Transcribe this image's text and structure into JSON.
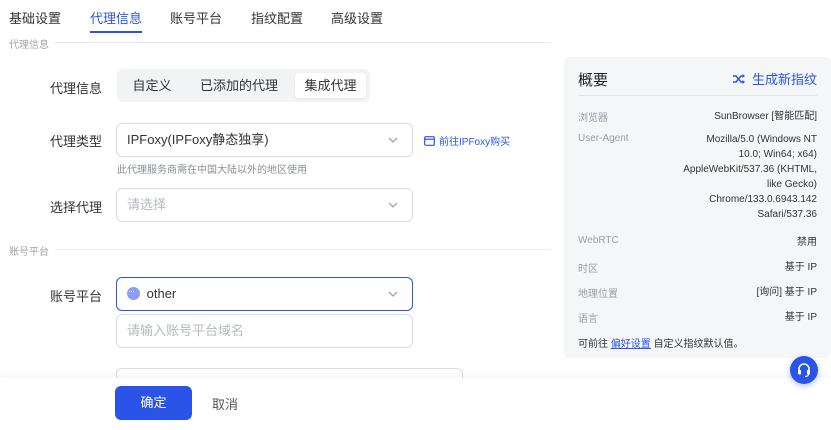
{
  "tabs": [
    {
      "label": "基础设置"
    },
    {
      "label": "代理信息"
    },
    {
      "label": "账号平台"
    },
    {
      "label": "指纹配置"
    },
    {
      "label": "高级设置"
    }
  ],
  "active_tab": "代理信息",
  "sections": {
    "proxy": "代理信息",
    "account": "账号平台"
  },
  "proxy": {
    "info_label": "代理信息",
    "modes": [
      "自定义",
      "已添加的代理",
      "集成代理"
    ],
    "active_mode": "集成代理",
    "type_label": "代理类型",
    "type_value": "IPFoxy(IPFoxy静态独享)",
    "buy_link": "前往IPFoxy购买",
    "help_text": "此代理服务商需在中国大陆以外的地区使用",
    "select_label": "选择代理",
    "select_placeholder": "请选择"
  },
  "account": {
    "platform_label": "账号平台",
    "platform_value": "other",
    "domain_placeholder": "请输入账号平台域名"
  },
  "footer": {
    "confirm": "确定",
    "cancel": "取消"
  },
  "overview": {
    "title": "概要",
    "generate": "生成新指纹",
    "rows": [
      {
        "label": "浏览器",
        "value": "SunBrowser [智能匹配]"
      },
      {
        "label": "User-Agent",
        "value": "Mozilla/5.0 (Windows NT 10.0; Win64; x64) AppleWebKit/537.36 (KHTML, like Gecko) Chrome/133.0.6943.142 Safari/537.36"
      },
      {
        "label": "WebRTC",
        "value": "禁用"
      },
      {
        "label": "时区",
        "value": "基于 IP"
      },
      {
        "label": "地理位置",
        "value": "[询问] 基于 IP"
      },
      {
        "label": "语言",
        "value": "基于 IP"
      }
    ],
    "footer_prefix": "可前往",
    "footer_link": "偏好设置",
    "footer_suffix": "自定义指纹默认值。"
  },
  "colors": {
    "accent": "#2a54e8",
    "panel_bg": "#f5f6f8"
  },
  "icons": {
    "generate": "shuffle-icon",
    "buy": "window-icon",
    "select": "chevron-down-icon",
    "support": "headset-icon"
  }
}
